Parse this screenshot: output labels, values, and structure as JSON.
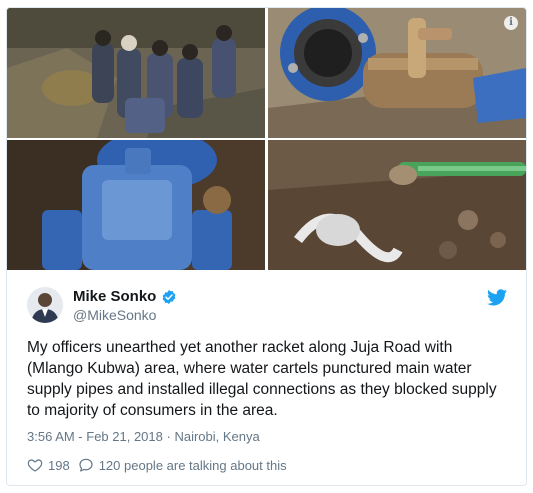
{
  "media": {
    "photos": [
      {
        "label": "Workers digging at excavation site"
      },
      {
        "label": "Blue water pipe flange with illegal connection"
      },
      {
        "label": "Blue gate valve in mud"
      },
      {
        "label": "Punctured pipe with green hose in soil"
      }
    ]
  },
  "author": {
    "name": "Mike Sonko",
    "handle": "@MikeSonko"
  },
  "tweet": {
    "text": "My  officers unearthed yet another racket along Juja Road with (Mlango Kubwa) area, where water cartels punctured main water supply pipes and installed illegal connections as they blocked supply to majority of consumers in the area.",
    "time": "3:56 AM - Feb 21, 2018",
    "separator": "·",
    "location": "Nairobi, Kenya"
  },
  "actions": {
    "likes": "198",
    "talking": "120 people are talking about this"
  },
  "colors": {
    "twitter_blue": "#1da1f2",
    "muted": "#657786",
    "text": "#14171a"
  }
}
